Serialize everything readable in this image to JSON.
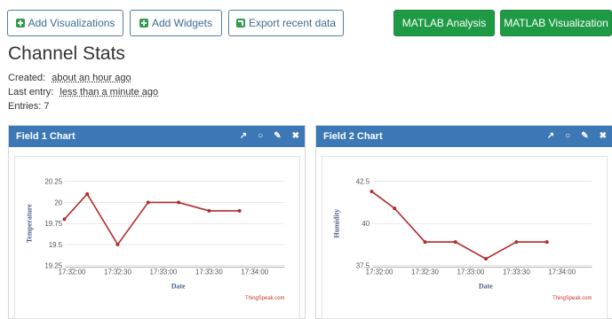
{
  "toolbar": {
    "add_visualizations": "Add Visualizations",
    "add_widgets": "Add Widgets",
    "export_recent": "Export recent data",
    "matlab_analysis": "MATLAB Analysis",
    "matlab_visualization": "MATLAB Visualization"
  },
  "page": {
    "title": "Channel Stats"
  },
  "meta": {
    "created_label": "Created:",
    "created_value": "about an hour ago",
    "last_entry_label": "Last entry:",
    "last_entry_value": "less than a minute ago",
    "entries": "Entries: 7"
  },
  "colors": {
    "header_blue": "#3b78b5",
    "action_green": "#1f9a44",
    "series_red": "#b22a2a"
  },
  "chart_data": [
    {
      "type": "line",
      "panel_title": "Field 1 Chart",
      "xlabel": "Date",
      "ylabel": "Temperature",
      "credit": "ThingSpeak.com",
      "x_ticks": [
        "17:32:00",
        "17:32:30",
        "17:33:00",
        "17:33:30",
        "17:34:00"
      ],
      "y_ticks": [
        "20.25",
        "20",
        "19.75",
        "19.5",
        "19.25"
      ],
      "ylim": [
        19.25,
        20.25
      ],
      "series": [
        {
          "x": [
            -5,
            10,
            30,
            50,
            70,
            90,
            110
          ],
          "y": [
            19.8,
            20.1,
            19.5,
            20.0,
            20.0,
            19.9,
            19.9
          ]
        }
      ]
    },
    {
      "type": "line",
      "panel_title": "Field 2 Chart",
      "xlabel": "Date",
      "ylabel": "Humidity",
      "credit": "ThingSpeak.com",
      "x_ticks": [
        "17:32:00",
        "17:32:30",
        "17:33:00",
        "17:33:30",
        "17:34:00"
      ],
      "y_ticks": [
        "42.5",
        "40",
        "37.5"
      ],
      "ylim": [
        37.5,
        42.5
      ],
      "series": [
        {
          "x": [
            -5,
            10,
            30,
            50,
            70,
            90,
            110
          ],
          "y": [
            41.9,
            40.9,
            38.9,
            38.9,
            37.9,
            38.9,
            38.9
          ]
        }
      ]
    }
  ]
}
